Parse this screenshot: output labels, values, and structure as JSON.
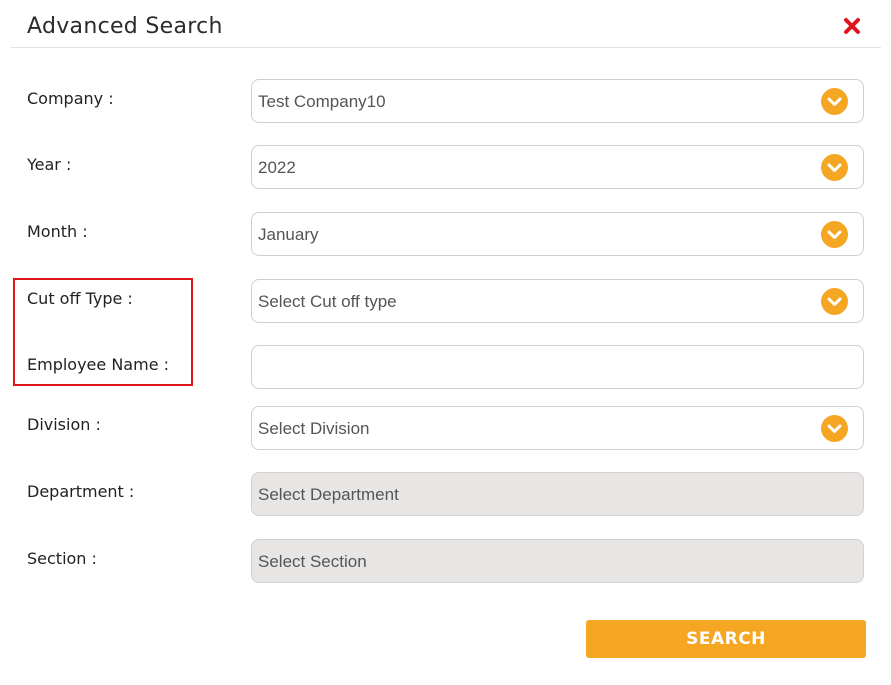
{
  "dialog": {
    "title": "Advanced Search"
  },
  "fields": {
    "company": {
      "label": "Company :",
      "value": "Test Company10"
    },
    "year": {
      "label": "Year :",
      "value": "2022"
    },
    "month": {
      "label": "Month :",
      "value": "January"
    },
    "cutoff_type": {
      "label": "Cut off Type :",
      "placeholder": "Select Cut off type"
    },
    "employee_name": {
      "label": "Employee Name :",
      "value": ""
    },
    "division": {
      "label": "Division :",
      "placeholder": "Select Division"
    },
    "department": {
      "label": "Department :",
      "placeholder": "Select Department"
    },
    "section": {
      "label": "Section :",
      "placeholder": "Select Section"
    }
  },
  "actions": {
    "search_label": "SEARCH"
  },
  "colors": {
    "accent": "#f5a623",
    "close": "#e0141b",
    "highlight": "#e0141b",
    "disabled_bg": "#e8e5e5"
  },
  "icons": {
    "close": "close-icon",
    "dropdown": "chevron-down-icon"
  }
}
